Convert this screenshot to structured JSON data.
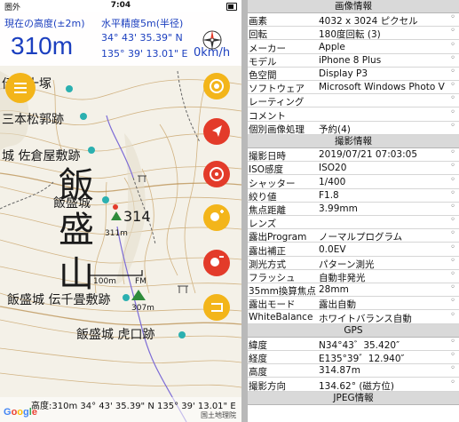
{
  "status_bar": {
    "carrier": "圏外",
    "time": "7:04"
  },
  "hud": {
    "altitude_label": "現在の高度(±2m)",
    "altitude": "310m",
    "accuracy_label": "水平精度5m(半径)",
    "latitude": "34° 43' 35.39\" N",
    "longitude": "135° 39' 13.01\" E",
    "speed": "0km/h"
  },
  "map": {
    "labels": {
      "shijo_tsuka": "伝三十塚",
      "sanbon_matsu": "三本松郭跡",
      "sakuraya": "城 佐倉屋敷跡",
      "mountain_1": "飯",
      "mountain_2": "盛",
      "mountain_3": "山",
      "meitsuka": "飯盛城",
      "summit": "314",
      "spot_311": "311m",
      "scale": "100m",
      "fm": "FM",
      "spot_307": "307m",
      "senjojiki": "飯盛城 伝千畳敷跡",
      "kokuchi": "飯盛城 虎口跡"
    },
    "bottom_coords": "高度:310m 34° 43' 35.39\" N 135° 39' 13.01\" E",
    "attribution": "国土地理院",
    "google": "Google"
  },
  "fab_icons": [
    "menu-icon",
    "layers-icon",
    "navigate-icon",
    "target-icon",
    "add-location-icon",
    "remove-location-icon",
    "track-icon"
  ],
  "exif": {
    "image_header": "画像情報",
    "image_rows": [
      {
        "key": "画素",
        "value": "4032 x 3024 ピクセル"
      },
      {
        "key": "回転",
        "value": "180度回転 (3)"
      },
      {
        "key": "メーカー",
        "value": "Apple"
      },
      {
        "key": "モデル",
        "value": "iPhone 8 Plus"
      },
      {
        "key": "色空間",
        "value": "Display P3"
      },
      {
        "key": "ソフトウェア",
        "value": "Microsoft Windows Photo V"
      },
      {
        "key": "レーティング",
        "value": ""
      },
      {
        "key": "コメント",
        "value": ""
      },
      {
        "key": "個別画像処理",
        "value": "予約(4)"
      }
    ],
    "shooting_header": "撮影情報",
    "shooting_rows": [
      {
        "key": "撮影日時",
        "value": "2019/07/21 07:03:05"
      },
      {
        "key": "ISO感度",
        "value": "ISO20"
      },
      {
        "key": "シャッター",
        "value": "1/400"
      },
      {
        "key": "絞り値",
        "value": "F1.8"
      },
      {
        "key": "焦点距離",
        "value": "3.99mm"
      },
      {
        "key": "レンズ",
        "value": ""
      },
      {
        "key": "露出Program",
        "value": "ノーマルプログラム"
      },
      {
        "key": "露出補正",
        "value": "0.0EV"
      },
      {
        "key": "測光方式",
        "value": "パターン測光"
      },
      {
        "key": "フラッシュ",
        "value": "自動非発光"
      },
      {
        "key": "35mm換算焦点",
        "value": "28mm"
      },
      {
        "key": "露出モード",
        "value": "露出自動"
      },
      {
        "key": "WhiteBalance",
        "value": "ホワイトバランス自動"
      }
    ],
    "gps_header": "GPS",
    "gps_rows": [
      {
        "key": "緯度",
        "value": "N34°43゛35.420″"
      },
      {
        "key": "経度",
        "value": "E135°39゛12.940″"
      },
      {
        "key": "高度",
        "value": "314.87m"
      },
      {
        "key": "撮影方向",
        "value": "134.62° (磁方位)"
      }
    ],
    "next_header": "JPEG情報",
    "dot": "◦"
  },
  "colors": {
    "accent_blue": "#1b3fbf",
    "fab_orange": "#f3b51a",
    "fab_red": "#e33b2a",
    "header_gray": "#d9d9d9"
  }
}
